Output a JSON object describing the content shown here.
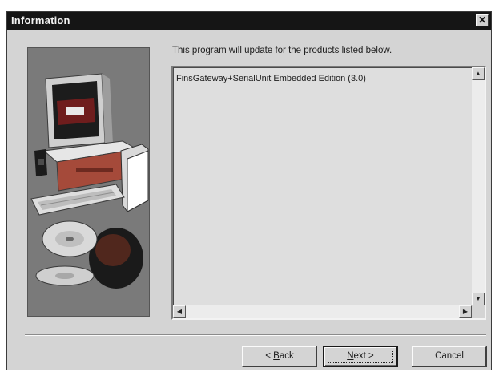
{
  "window": {
    "title": "Information",
    "close_glyph": "✕"
  },
  "main": {
    "heading": "This program will update for the products listed below.",
    "products": [
      "FinsGateway+SerialUnit Embedded Edition (3.0)"
    ]
  },
  "scrollbar": {
    "up_glyph": "▲",
    "down_glyph": "▼",
    "left_glyph": "◀",
    "right_glyph": "▶"
  },
  "buttons": {
    "back_prefix": "< ",
    "back_hotkey": "B",
    "back_rest": "ack",
    "next_hotkey": "N",
    "next_rest": "ext >",
    "cancel_label": "Cancel"
  },
  "graphic": {
    "icon": "setup-computer-and-cd-illustration",
    "panel_color": "#7a7a7a"
  }
}
